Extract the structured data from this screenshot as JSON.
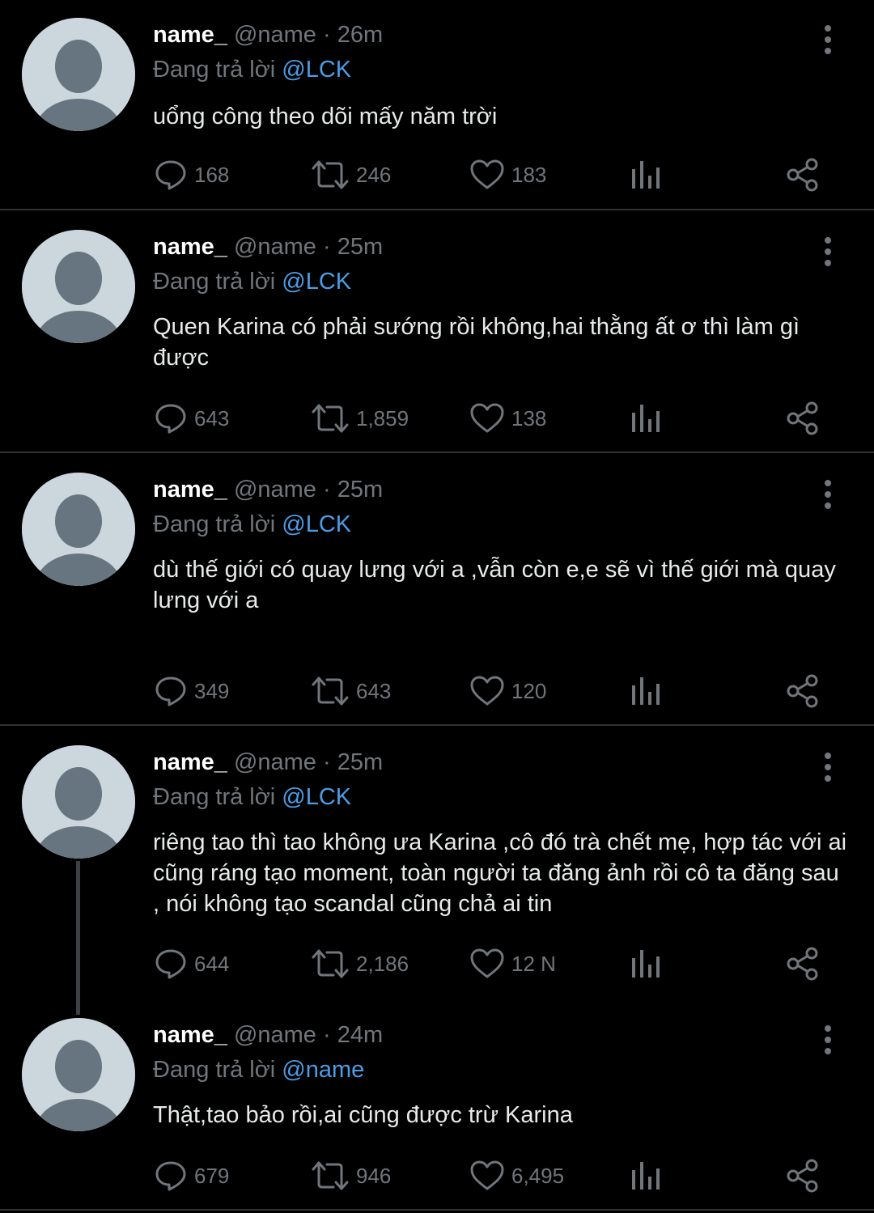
{
  "tweets": [
    {
      "name": "name_",
      "handle": "@name",
      "time": "26m",
      "reply_prefix": "Đang trả lời",
      "reply_to": "@LCK",
      "text": "uổng công theo dõi mấy năm trời",
      "replies": "168",
      "retweets": "246",
      "likes": "183"
    },
    {
      "name": "name_",
      "handle": "@name",
      "time": "25m",
      "reply_prefix": "Đang trả lời",
      "reply_to": "@LCK",
      "text": "Quen Karina có phải sướng rồi không,hai thằng ất ơ thì làm gì được",
      "replies": "643",
      "retweets": "1,859",
      "likes": "138"
    },
    {
      "name": "name_",
      "handle": "@name",
      "time": "25m",
      "reply_prefix": "Đang trả lời",
      "reply_to": "@LCK",
      "text": "dù thế giới có quay lưng với a ,vẫn còn e,e sẽ vì thế giới mà quay lưng với a",
      "replies": "349",
      "retweets": "643",
      "likes": "120"
    },
    {
      "name": "name_",
      "handle": "@name",
      "time": "25m",
      "reply_prefix": "Đang trả lời",
      "reply_to": "@LCK",
      "text": "riêng tao thì tao không ưa Karina ,cô đó trà chết mẹ, hợp tác với ai cũng ráng tạo moment, toàn người ta đăng ảnh rồi cô ta đăng sau , nói không tạo scandal cũng chả ai tin",
      "replies": "644",
      "retweets": "2,186",
      "likes": "12 N"
    },
    {
      "name": "name_",
      "handle": "@name",
      "time": "24m",
      "reply_prefix": "Đang trả lời",
      "reply_to": "@name",
      "text": "Thật,tao bảo rồi,ai cũng được trừ Karina",
      "replies": "679",
      "retweets": "946",
      "likes": "6,495"
    }
  ],
  "icons": {
    "reply": "speech-bubble-icon",
    "retweet": "retweet-arrows-icon",
    "like": "heart-icon",
    "views": "bar-chart-icon",
    "share": "share-nodes-icon",
    "more": "vertical-dots-icon"
  },
  "colors": {
    "background": "#000000",
    "text": "#e7e9ea",
    "muted": "#71767b",
    "mention": "#4a9de6",
    "avatar_bg": "#ccd6dd",
    "avatar_fg": "#66757f"
  }
}
